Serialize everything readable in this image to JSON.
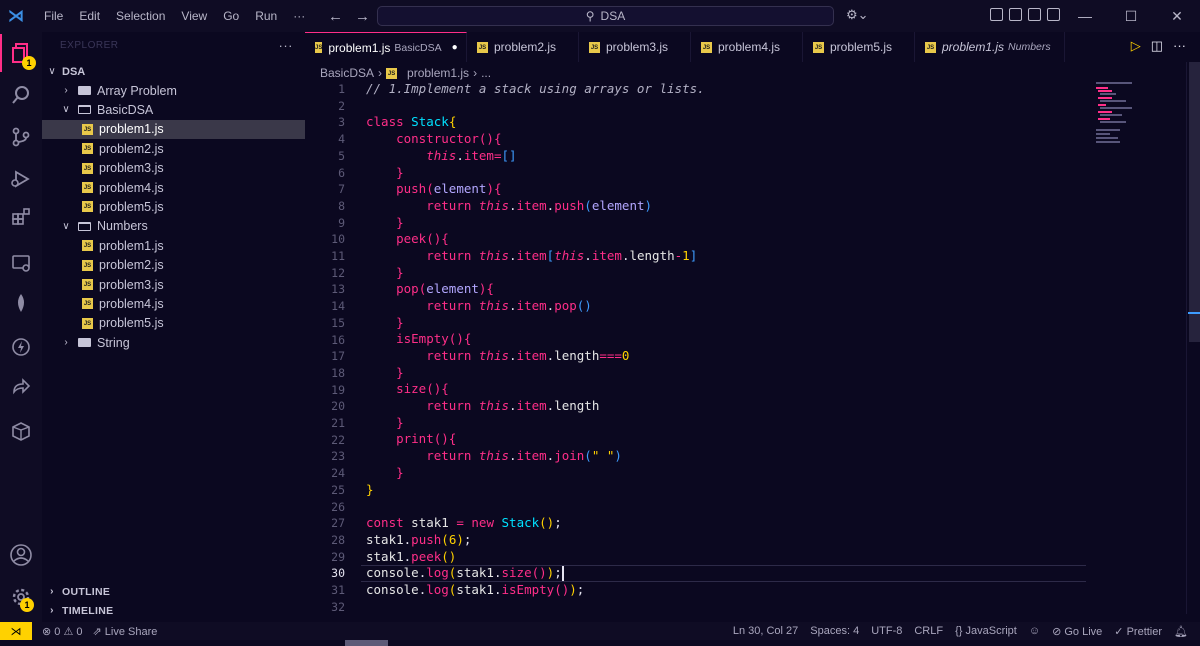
{
  "titlebar": {
    "menu": [
      "File",
      "Edit",
      "Selection",
      "View",
      "Go",
      "Run",
      "···"
    ],
    "command_center": "DSA",
    "nav_back": "←",
    "nav_forward": "→",
    "min": "—",
    "max": "☐",
    "close": "✕"
  },
  "activity": {
    "explorer_badge": "1",
    "settings_badge": "1"
  },
  "sidebar": {
    "header": "EXPLORER",
    "more": "···",
    "root": "DSA",
    "items": [
      {
        "label": "Array Problem",
        "type": "folder",
        "open": false
      },
      {
        "label": "BasicDSA",
        "type": "folder",
        "open": true
      },
      {
        "label": "problem1.js",
        "type": "file",
        "selected": true
      },
      {
        "label": "problem2.js",
        "type": "file"
      },
      {
        "label": "problem3.js",
        "type": "file"
      },
      {
        "label": "problem4.js",
        "type": "file"
      },
      {
        "label": "problem5.js",
        "type": "file"
      },
      {
        "label": "Numbers",
        "type": "folder",
        "open": true
      },
      {
        "label": "problem1.js",
        "type": "file"
      },
      {
        "label": "problem2.js",
        "type": "file"
      },
      {
        "label": "problem3.js",
        "type": "file"
      },
      {
        "label": "problem4.js",
        "type": "file"
      },
      {
        "label": "problem5.js",
        "type": "file"
      },
      {
        "label": "String",
        "type": "folder",
        "open": false
      }
    ],
    "outline": "OUTLINE",
    "timeline": "TIMELINE"
  },
  "tabs": [
    {
      "label": "problem1.js",
      "desc": "BasicDSA",
      "active": true,
      "dirty": true
    },
    {
      "label": "problem2.js",
      "desc": ""
    },
    {
      "label": "problem3.js",
      "desc": ""
    },
    {
      "label": "problem4.js",
      "desc": ""
    },
    {
      "label": "problem5.js",
      "desc": ""
    },
    {
      "label": "problem1.js",
      "desc": "Numbers",
      "italic": true
    }
  ],
  "breadcrumb": {
    "folder": "BasicDSA",
    "file": "problem1.js",
    "trail": "..."
  },
  "editor": {
    "current_line": 30,
    "line_numbers": [
      "1",
      "2",
      "3",
      "4",
      "5",
      "6",
      "7",
      "8",
      "9",
      "10",
      "11",
      "12",
      "13",
      "14",
      "15",
      "16",
      "17",
      "18",
      "19",
      "20",
      "21",
      "22",
      "23",
      "24",
      "25",
      "26",
      "27",
      "28",
      "29",
      "30",
      "31",
      "32"
    ]
  },
  "status": {
    "problems": "⊗ 0 ⚠ 0",
    "live_share": "Live Share",
    "position": "Ln 30, Col 27",
    "spaces": "Spaces: 4",
    "encoding": "UTF-8",
    "eol": "CRLF",
    "language": "{} JavaScript",
    "go_live": "Go Live",
    "prettier": "✓ Prettier"
  },
  "colors": {
    "accent": "#ff2e88",
    "badge": "#ffd100",
    "type": "#00e1ff"
  }
}
